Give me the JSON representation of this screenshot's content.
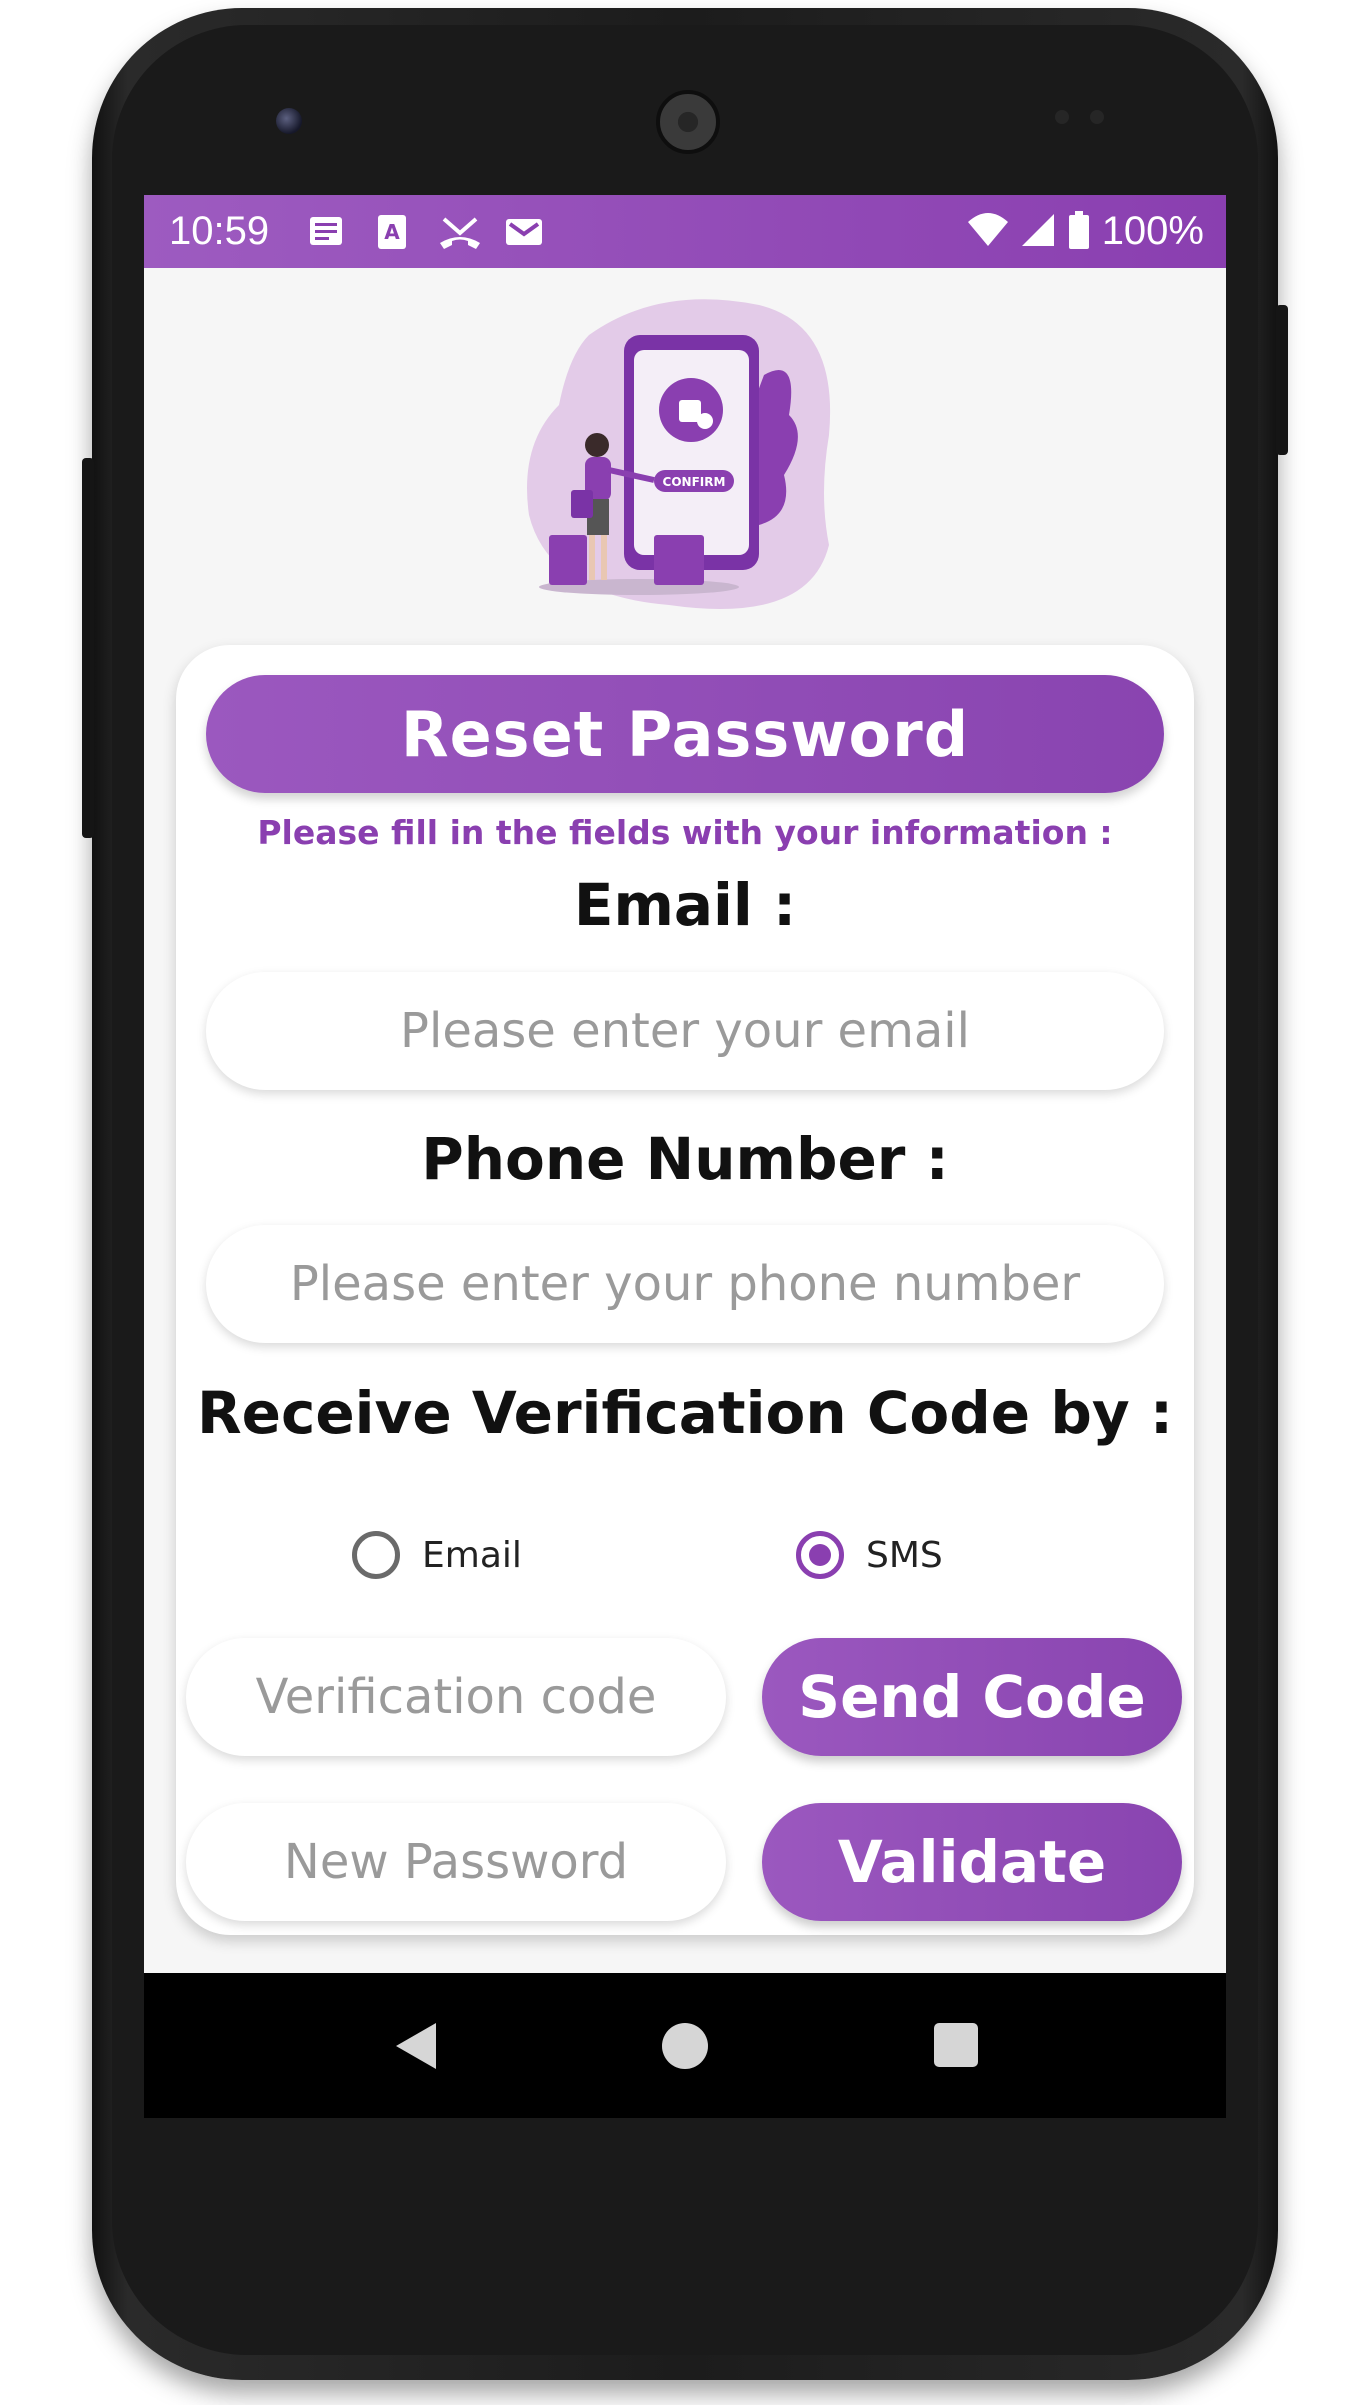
{
  "status_bar": {
    "time": "10:59",
    "battery": "100%",
    "left_icons": [
      "notes-icon",
      "text-icon",
      "missed-call-icon",
      "mail-icon"
    ],
    "right_icons": [
      "wifi-icon",
      "signal-icon",
      "battery-icon"
    ]
  },
  "form": {
    "title": "Reset Password",
    "subtitle": "Please fill in the fields with your information :",
    "email_label": "Email :",
    "email_placeholder": "Please enter your email",
    "phone_label": "Phone Number :",
    "phone_placeholder": "Please enter your phone number",
    "verification_label": "Receive Verification Code by :",
    "options": [
      {
        "label": "Email",
        "checked": false
      },
      {
        "label": "SMS",
        "checked": true
      }
    ],
    "code_placeholder": "Verification code",
    "send_code_label": "Send Code",
    "new_password_placeholder": "New Password",
    "validate_label": "Validate"
  },
  "illustration": {
    "confirm_text": "CONFIRM"
  },
  "colors": {
    "accent": "#8a3fb0",
    "accent_light": "#9b58bf",
    "blob": "#e3cbe8"
  },
  "nav": {
    "icons": [
      "back-icon",
      "home-icon",
      "recent-apps-icon"
    ]
  }
}
